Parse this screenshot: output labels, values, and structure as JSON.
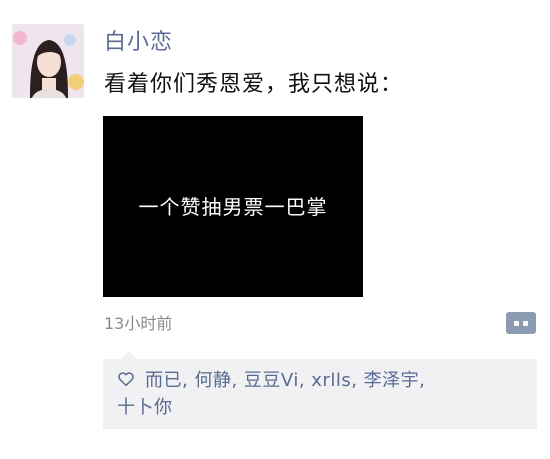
{
  "post": {
    "username": "白小恋",
    "text": "看着你们秀恩爱，我只想说：",
    "image_caption": "一个赞抽男票一巴掌",
    "timestamp": "13小时前"
  },
  "likes": {
    "icon": "heart-outline-icon",
    "names": [
      "而已",
      "何静",
      "豆豆Vi",
      "xrlls",
      "李泽宇",
      "十卜你"
    ],
    "separator": ", "
  },
  "colors": {
    "username": "#5b6b93",
    "link": "#596a92",
    "panel_bg": "#f1f1f3",
    "comment_button": "#8b9bb2"
  }
}
